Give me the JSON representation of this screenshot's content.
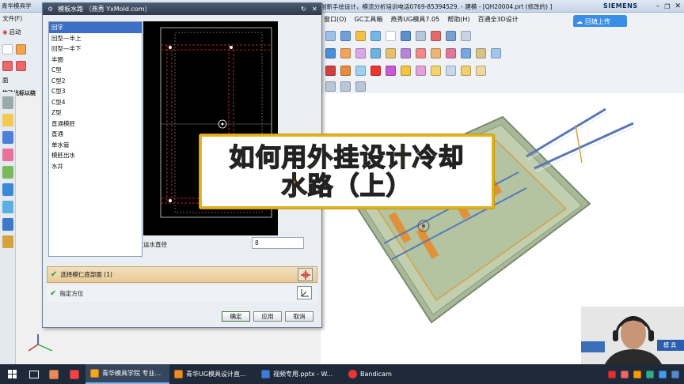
{
  "app": {
    "window_title": "创新手绘设计，模流分析培训电话0769-85394529. - 建模 - [QH20004.prt (修改的) ]",
    "brand": "SIEMENS",
    "upload_label": "回填上传",
    "taskbar_start_title": "青华模具学"
  },
  "menubar": {
    "items": [
      "窗口(O)",
      "GC工具箱",
      "燕秀UG模具7.05",
      "帮助(H)",
      "百通全3D设计"
    ]
  },
  "left_toolbar": {
    "file_label": "文件(F)",
    "start_label": "启动",
    "face_label": "面",
    "drag_label": "拖动光标以绕"
  },
  "dialog": {
    "title": "模板水路  （燕秀 YxMold.com）",
    "list": [
      "回字",
      "回型—半上",
      "回型—半下",
      "半圈",
      "C型",
      "C型2",
      "C型3",
      "C型4",
      "Z型",
      "直通模胚",
      "直通",
      "单水管",
      "模胚出水",
      "水井"
    ],
    "selected_index": 0,
    "diameter_label": "运水直径",
    "diameter_value": "8",
    "section1_label": "选择模仁底部面 (1)",
    "section2_label": "指定方位",
    "ok_label": "确定",
    "apply_label": "应用",
    "cancel_label": "取消"
  },
  "banner": {
    "line1": "如何用外挂设计冷却",
    "line2": "水路（上）"
  },
  "webcam": {
    "bg_text": "模 具"
  },
  "taskbar": {
    "apps": [
      {
        "label": "青华模具学院 专业...",
        "active": true
      },
      {
        "label": "青华UG模具设计直...",
        "active": false
      },
      {
        "label": "视频专用.pptx - W...",
        "active": false
      },
      {
        "label": "Bandicam",
        "active": false
      }
    ]
  }
}
